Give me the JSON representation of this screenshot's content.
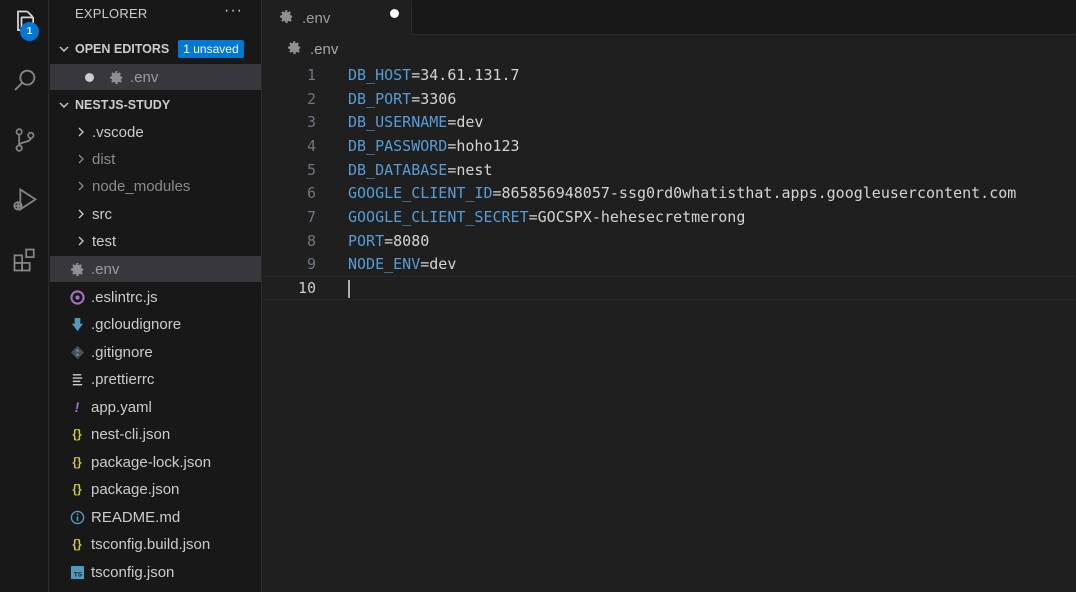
{
  "activity_bar": {
    "items": [
      {
        "name": "explorer",
        "icon": "files-icon",
        "badge": "1"
      },
      {
        "name": "search",
        "icon": "search-icon"
      },
      {
        "name": "source-control",
        "icon": "source-control-icon"
      },
      {
        "name": "run-debug",
        "icon": "run-debug-icon"
      },
      {
        "name": "extensions",
        "icon": "extensions-icon"
      }
    ],
    "explorer_badge": "1"
  },
  "sidebar": {
    "title": "EXPLORER",
    "more_label": "···",
    "open_editors": {
      "label": "OPEN EDITORS",
      "badge": "1 unsaved",
      "items": [
        {
          "label": ".env",
          "icon": "gear-icon",
          "unsaved": true
        }
      ]
    },
    "project": {
      "label": "NESTJS-STUDY",
      "folders": [
        {
          "label": ".vscode",
          "dim": false
        },
        {
          "label": "dist",
          "dim": true
        },
        {
          "label": "node_modules",
          "dim": true
        },
        {
          "label": "src",
          "dim": false
        },
        {
          "label": "test",
          "dim": false
        }
      ],
      "files": [
        {
          "label": ".env",
          "icon": "gear-icon",
          "selected": true
        },
        {
          "label": ".eslintrc.js",
          "icon": "eslint-icon"
        },
        {
          "label": ".gcloudignore",
          "icon": "download-arrow-icon"
        },
        {
          "label": ".gitignore",
          "icon": "git-icon"
        },
        {
          "label": ".prettierrc",
          "icon": "lines-icon"
        },
        {
          "label": "app.yaml",
          "icon": "exclamation-icon"
        },
        {
          "label": "nest-cli.json",
          "icon": "json-braces-icon"
        },
        {
          "label": "package-lock.json",
          "icon": "json-braces-icon"
        },
        {
          "label": "package.json",
          "icon": "json-braces-icon"
        },
        {
          "label": "README.md",
          "icon": "info-icon"
        },
        {
          "label": "tsconfig.build.json",
          "icon": "json-braces-icon"
        },
        {
          "label": "tsconfig.json",
          "icon": "typescript-icon"
        }
      ]
    }
  },
  "tabs": [
    {
      "label": ".env",
      "icon": "gear-icon",
      "unsaved": true
    }
  ],
  "breadcrumb": {
    "label": ".env",
    "icon": "gear-icon"
  },
  "editor": {
    "lines": [
      {
        "num": "1",
        "key": "DB_HOST",
        "eq": "=",
        "value": "34.61.131.7"
      },
      {
        "num": "2",
        "key": "DB_PORT",
        "eq": "=",
        "value": "3306"
      },
      {
        "num": "3",
        "key": "DB_USERNAME",
        "eq": "=",
        "value": "dev"
      },
      {
        "num": "4",
        "key": "DB_PASSWORD",
        "eq": "=",
        "value": "hoho123"
      },
      {
        "num": "5",
        "key": "DB_DATABASE",
        "eq": "=",
        "value": "nest"
      },
      {
        "num": "6",
        "key": "GOOGLE_CLIENT_ID",
        "eq": "=",
        "value": "865856948057-ssg0rd0whatisthat.apps.googleusercontent.com"
      },
      {
        "num": "7",
        "key": "GOOGLE_CLIENT_SECRET",
        "eq": "=",
        "value": "GOCSPX-hehesecretmerong"
      },
      {
        "num": "8",
        "key": "PORT",
        "eq": "=",
        "value": "8080"
      },
      {
        "num": "9",
        "key": "NODE_ENV",
        "eq": "=",
        "value": "dev"
      },
      {
        "num": "10",
        "key": "",
        "eq": "",
        "value": ""
      }
    ],
    "current_line": "10"
  },
  "colors": {
    "accent": "#0078d4",
    "key": "#569cd6",
    "text": "#d4d4d4",
    "json_icon": "#cbcb41",
    "eslint_icon": "#a074c4",
    "info_icon": "#519aba"
  }
}
